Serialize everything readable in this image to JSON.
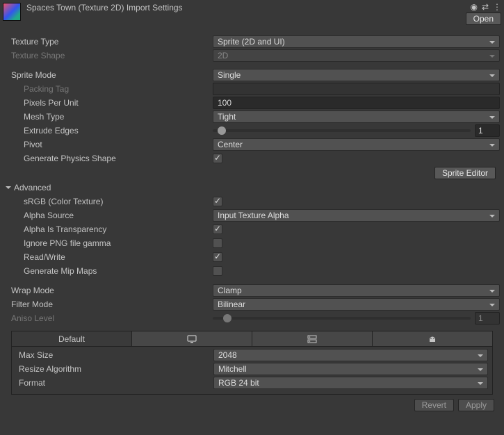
{
  "header": {
    "title": "Spaces Town (Texture 2D) Import Settings",
    "open_label": "Open"
  },
  "fields": {
    "texture_type": {
      "label": "Texture Type",
      "value": "Sprite (2D and UI)"
    },
    "texture_shape": {
      "label": "Texture Shape",
      "value": "2D"
    },
    "sprite_mode": {
      "label": "Sprite Mode",
      "value": "Single"
    },
    "packing_tag": {
      "label": "Packing Tag",
      "value": ""
    },
    "pixels_per_unit": {
      "label": "Pixels Per Unit",
      "value": "100"
    },
    "mesh_type": {
      "label": "Mesh Type",
      "value": "Tight"
    },
    "extrude_edges": {
      "label": "Extrude Edges",
      "value": "1"
    },
    "pivot": {
      "label": "Pivot",
      "value": "Center"
    },
    "generate_physics_shape": {
      "label": "Generate Physics Shape",
      "checked": true
    },
    "sprite_editor_btn": "Sprite Editor",
    "advanced_label": "Advanced",
    "srgb": {
      "label": "sRGB (Color Texture)",
      "checked": true
    },
    "alpha_source": {
      "label": "Alpha Source",
      "value": "Input Texture Alpha"
    },
    "alpha_is_transparency": {
      "label": "Alpha Is Transparency",
      "checked": true
    },
    "ignore_png_gamma": {
      "label": "Ignore PNG file gamma",
      "checked": false
    },
    "read_write": {
      "label": "Read/Write",
      "checked": true
    },
    "generate_mip_maps": {
      "label": "Generate Mip Maps",
      "checked": false
    },
    "wrap_mode": {
      "label": "Wrap Mode",
      "value": "Clamp"
    },
    "filter_mode": {
      "label": "Filter Mode",
      "value": "Bilinear"
    },
    "aniso_level": {
      "label": "Aniso Level",
      "value": "1"
    }
  },
  "platform_tabs": {
    "default": "Default"
  },
  "platform": {
    "max_size": {
      "label": "Max Size",
      "value": "2048"
    },
    "resize_algorithm": {
      "label": "Resize Algorithm",
      "value": "Mitchell"
    },
    "format": {
      "label": "Format",
      "value": "RGB 24 bit"
    }
  },
  "footer": {
    "revert": "Revert",
    "apply": "Apply"
  }
}
